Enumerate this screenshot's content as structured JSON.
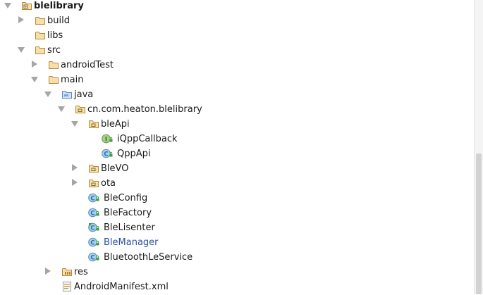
{
  "tree": {
    "rows": [
      {
        "label": "blelibrary",
        "icon": "module-folder",
        "arrow": "down",
        "bold": true
      },
      {
        "label": "build",
        "icon": "folder",
        "arrow": "right"
      },
      {
        "label": "libs",
        "icon": "folder",
        "arrow": "none"
      },
      {
        "label": "src",
        "icon": "folder",
        "arrow": "down"
      },
      {
        "label": "androidTest",
        "icon": "folder",
        "arrow": "right"
      },
      {
        "label": "main",
        "icon": "folder",
        "arrow": "down"
      },
      {
        "label": "java",
        "icon": "source-folder",
        "arrow": "down"
      },
      {
        "label": "cn.com.heaton.blelibrary",
        "icon": "package",
        "arrow": "down"
      },
      {
        "label": "bleApi",
        "icon": "package",
        "arrow": "down"
      },
      {
        "label": "iQppCallback",
        "icon": "interface",
        "arrow": "none"
      },
      {
        "label": "QppApi",
        "icon": "class",
        "arrow": "none"
      },
      {
        "label": "BleVO",
        "icon": "package",
        "arrow": "right"
      },
      {
        "label": "ota",
        "icon": "package",
        "arrow": "right"
      },
      {
        "label": "BleConfig",
        "icon": "class",
        "arrow": "none"
      },
      {
        "label": "BleFactory",
        "icon": "class",
        "arrow": "none"
      },
      {
        "label": "BleLisenter",
        "icon": "abstract-class",
        "arrow": "none"
      },
      {
        "label": "BleManager",
        "icon": "class",
        "arrow": "none",
        "highlight": true
      },
      {
        "label": "BluetoothLeService",
        "icon": "class",
        "arrow": "none"
      },
      {
        "label": "res",
        "icon": "resource-folder",
        "arrow": "right"
      },
      {
        "label": "AndroidManifest.xml",
        "icon": "manifest-file",
        "arrow": "none"
      }
    ]
  },
  "colors": {
    "folder": "#d7b46c",
    "source_folder": "#7ca6d6",
    "class": "#a6cfe8",
    "interface": "#a9d18e",
    "lock_badge": "#3b9e3b",
    "highlight_text": "#2851a0",
    "tree_arrow": "#a5a5a5"
  }
}
